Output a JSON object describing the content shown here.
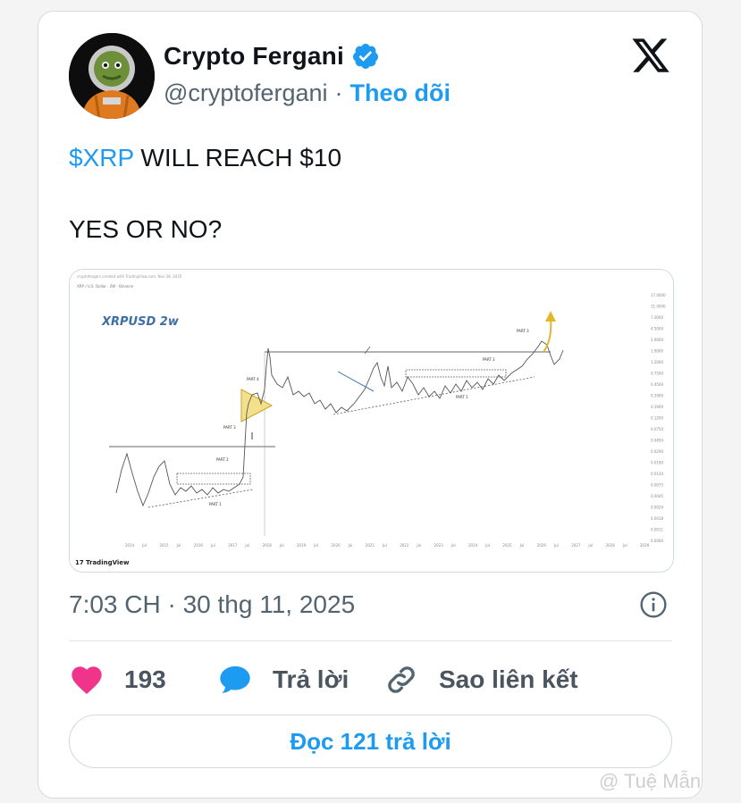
{
  "author": {
    "name": "Crypto Fergani",
    "handle": "@cryptofergani",
    "separator": "·",
    "follow_label": "Theo dõi"
  },
  "tweet": {
    "cashtag": "$XRP",
    "line1_rest": " WILL REACH $10",
    "line2": "YES OR NO?"
  },
  "media": {
    "chart_title": "XRPUSD 2w",
    "brand": "TradingView",
    "part_labels": [
      "PART 1",
      "PART 2",
      "PART 3",
      "PART 4",
      "PART 1",
      "PART 2",
      "PART 3"
    ],
    "x_ticks": [
      "2014",
      "Jul",
      "2015",
      "Jul",
      "2016",
      "Jul",
      "2017",
      "Jul",
      "2018",
      "Jul",
      "2019",
      "Jul",
      "2020",
      "Jul",
      "2021",
      "Jul",
      "2022",
      "Jul",
      "2023",
      "Jul",
      "2024",
      "Jul",
      "2025",
      "Jul",
      "2026",
      "Jul",
      "2027",
      "Jul",
      "2028",
      "Jul",
      "2029"
    ],
    "y_ticks": [
      "17.0000",
      "11.0000",
      "7.0000",
      "4.5000",
      "2.9000",
      "1.9000",
      "1.2000",
      "0.7500",
      "0.4500",
      "0.2900",
      "0.1900",
      "0.1200",
      "0.0750",
      "0.0450",
      "0.0290",
      "0.0190",
      "0.0120",
      "0.0075",
      "0.0045",
      "0.0029",
      "0.0018",
      "0.0011",
      "0.0006"
    ]
  },
  "meta": {
    "timestamp": "7:03 CH · 30 thg 11, 2025"
  },
  "actions": {
    "likes": "193",
    "reply_label": "Trả lời",
    "copy_label": "Sao liên kết"
  },
  "read_replies_label": "Đọc 121 trả lời",
  "watermark": "@ Tuệ Mẫn",
  "colors": {
    "accent": "#1d9bf0",
    "like": "#f0338b",
    "text_secondary": "#536471"
  }
}
